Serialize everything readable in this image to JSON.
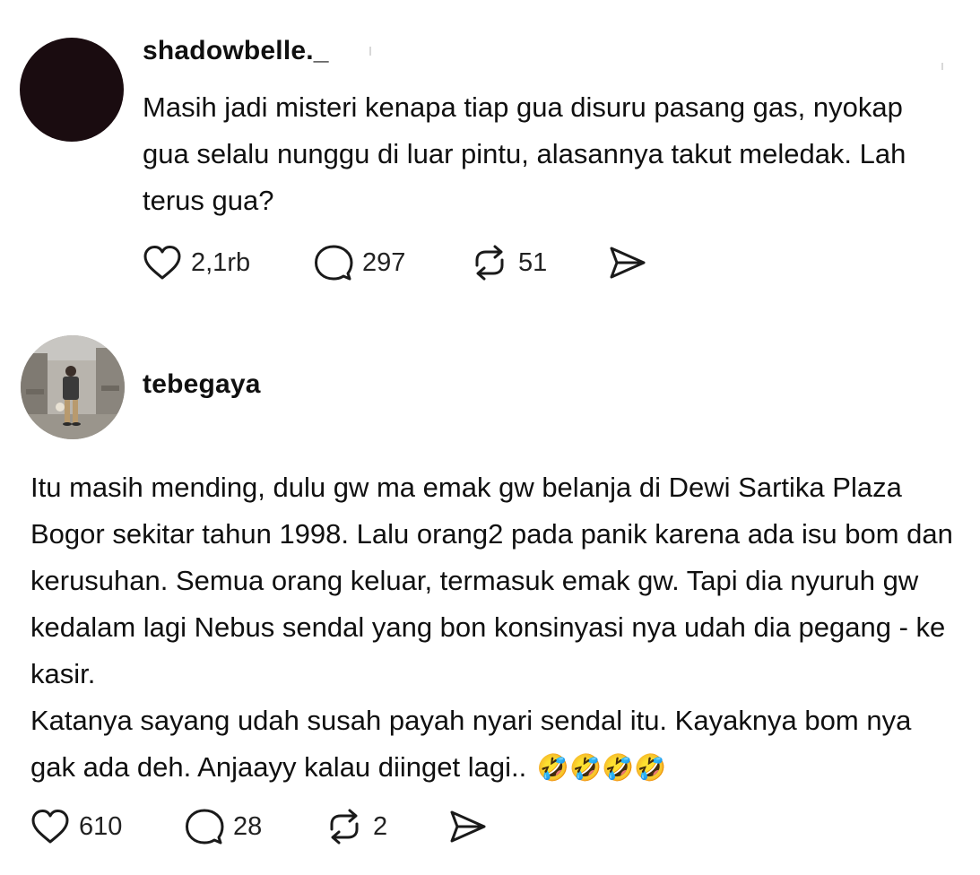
{
  "posts": [
    {
      "username": "shadowbelle._",
      "text": "Masih jadi misteri kenapa tiap gua disuru pasang gas, nyokap gua selalu nunggu di luar pintu, alasannya takut meledak. Lah terus gua?",
      "likes": "2,1rb",
      "replies": "297",
      "reposts": "51"
    },
    {
      "username": "tebegaya",
      "text_paragraph_1": "Itu masih mending, dulu gw ma emak gw belanja di Dewi Sartika Plaza Bogor sekitar tahun 1998. Lalu orang2 pada panik karena ada isu bom dan kerusuhan. Semua orang keluar, termasuk emak gw. Tapi dia nyuruh gw kedalam lagi Nebus sendal yang bon konsinyasi nya udah dia pegang - ke kasir.",
      "text_paragraph_2": "Katanya sayang udah susah payah nyari sendal itu. Kayaknya bom nya gak ada deh. Anjaayy kalau diinget lagi..",
      "emojis": "🤣🤣🤣🤣",
      "likes": "610",
      "replies": "28",
      "reposts": "2"
    }
  ],
  "icons": {
    "like": "heart-icon",
    "reply": "speech-bubble-icon",
    "repost": "repost-arrows-icon",
    "share": "paper-plane-icon"
  },
  "colors": {
    "text": "#101010",
    "icon": "#1a1a1a",
    "avatar_dark": "#1a0c10"
  }
}
